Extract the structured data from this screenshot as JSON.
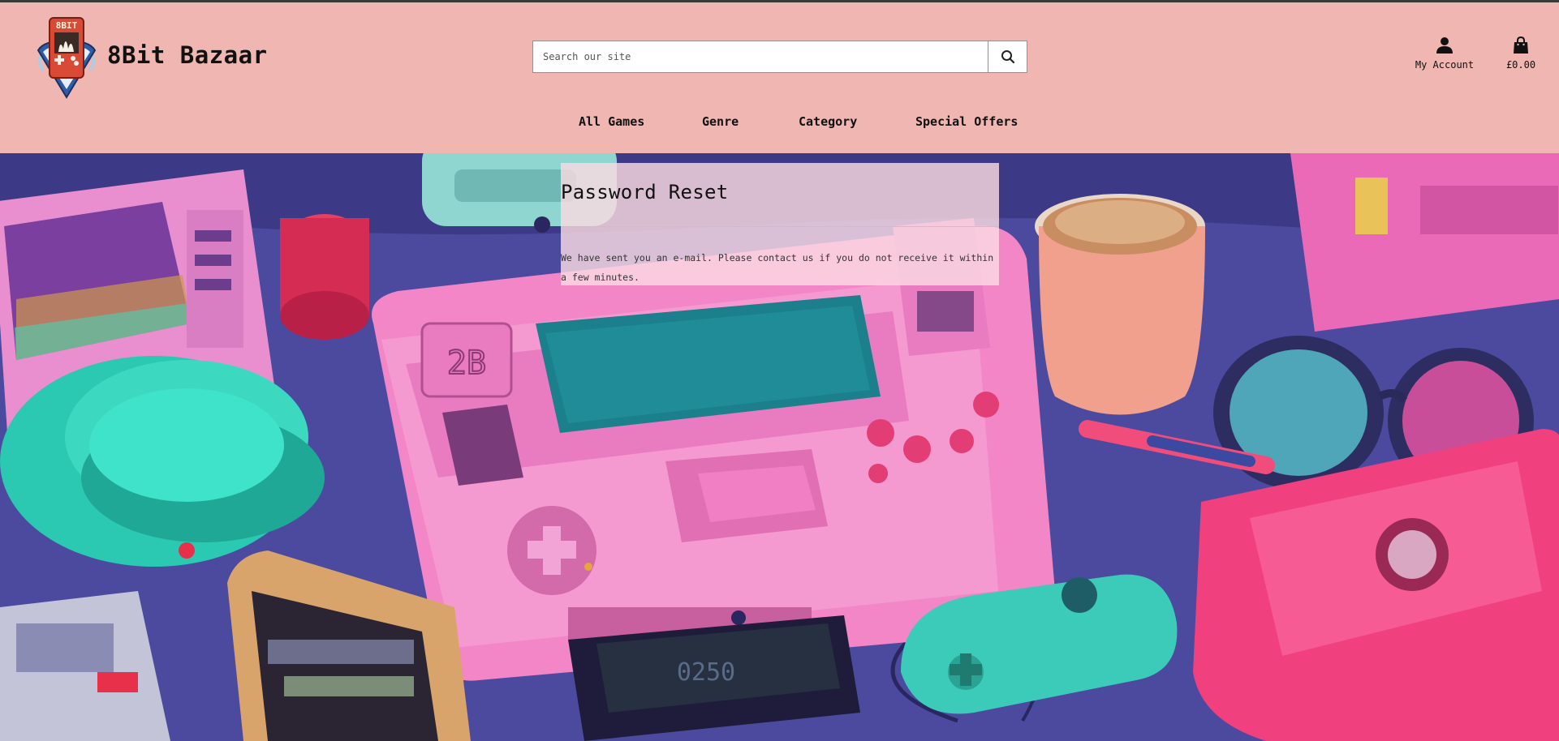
{
  "brand": {
    "logo_text": "8BIT",
    "name": "8Bit Bazaar"
  },
  "search": {
    "placeholder": "Search our site",
    "value": ""
  },
  "header_actions": {
    "account_label": "My Account",
    "cart_total": "£0.00"
  },
  "nav": {
    "items": [
      "All Games",
      "Genre",
      "Category",
      "Special Offers"
    ]
  },
  "panel": {
    "title": "Password Reset",
    "message": "We have sent you an e-mail. Please contact us if you do not receive it within a few minutes."
  },
  "colors": {
    "header_bg": "#efb6b2",
    "hero_bg": "#4b4a9e",
    "panel_bg": "#fadae2",
    "console_pink": "#f286c6",
    "accent_teal": "#2bc8b2",
    "accent_magenta": "#f0407e"
  },
  "icons": {
    "search": "search-icon",
    "account": "user-icon",
    "cart": "shopping-bag-icon"
  }
}
